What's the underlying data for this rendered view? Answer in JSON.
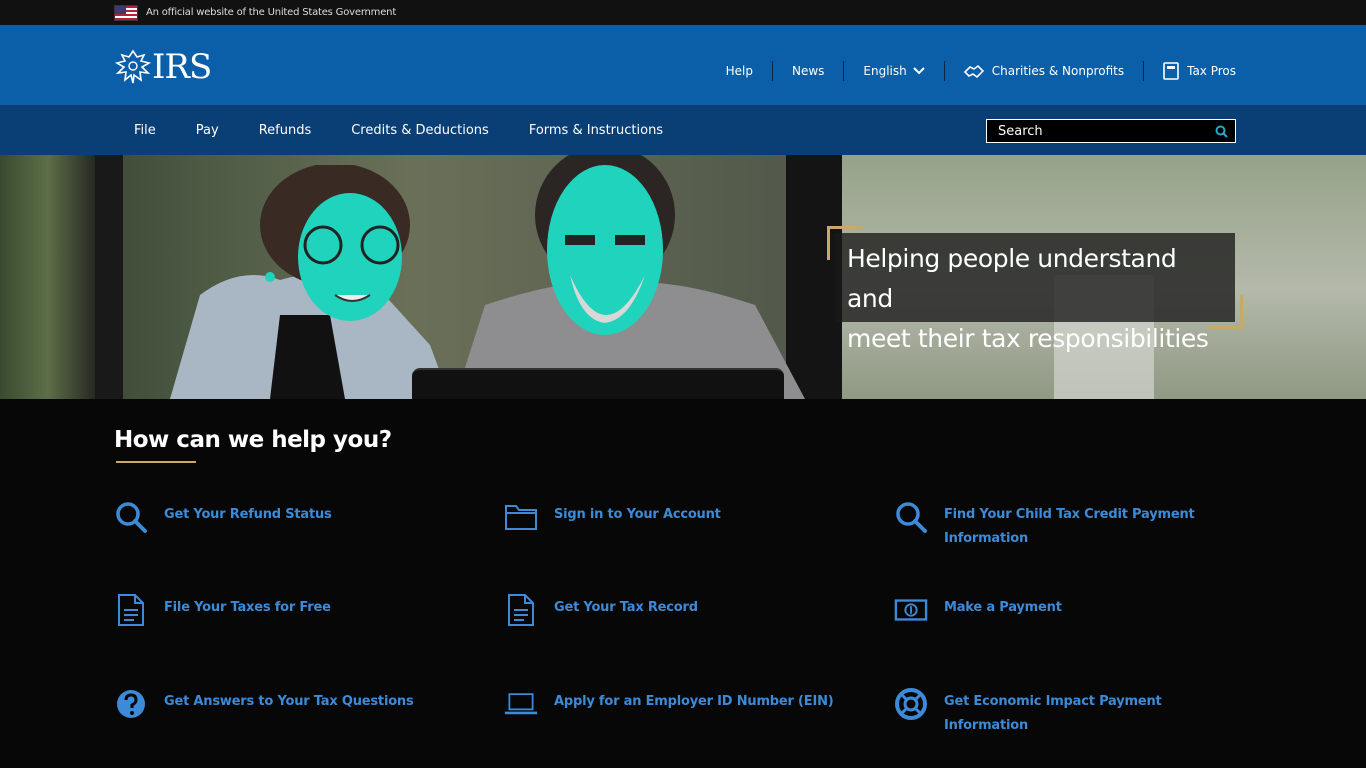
{
  "gov_banner": {
    "text": "An official website of the United States Government"
  },
  "header": {
    "logo_text": "IRS",
    "util_nav": {
      "help": "Help",
      "news": "News",
      "language": "English",
      "charities": "Charities & Nonprofits",
      "tax_pros": "Tax Pros"
    }
  },
  "main_nav": {
    "items": [
      "File",
      "Pay",
      "Refunds",
      "Credits & Deductions",
      "Forms & Instructions"
    ],
    "search_placeholder": "Search"
  },
  "hero": {
    "tagline_line1": "Helping people understand and",
    "tagline_line2": "meet their tax responsibilities"
  },
  "help_section": {
    "title": "How can we help you?",
    "tiles": [
      {
        "label": "Get Your Refund Status",
        "icon": "search-icon"
      },
      {
        "label": "Sign in to Your Account",
        "icon": "folder-icon"
      },
      {
        "label": "Find Your Child Tax Credit Payment Information",
        "icon": "search-icon"
      },
      {
        "label": "File Your Taxes for Free",
        "icon": "document-icon"
      },
      {
        "label": "Get Your Tax Record",
        "icon": "document-icon"
      },
      {
        "label": "Make a Payment",
        "icon": "money-icon"
      },
      {
        "label": "Get Answers to Your Tax Questions",
        "icon": "question-icon"
      },
      {
        "label": "Apply for an Employer ID Number (EIN)",
        "icon": "laptop-icon"
      },
      {
        "label": "Get Economic Impact Payment Information",
        "icon": "lifebuoy-icon"
      }
    ]
  },
  "colors": {
    "header_blue": "#0b5ea8",
    "nav_blue": "#0a3f76",
    "link_blue": "#3c8ad8",
    "accent_gold": "#c9a96a"
  }
}
